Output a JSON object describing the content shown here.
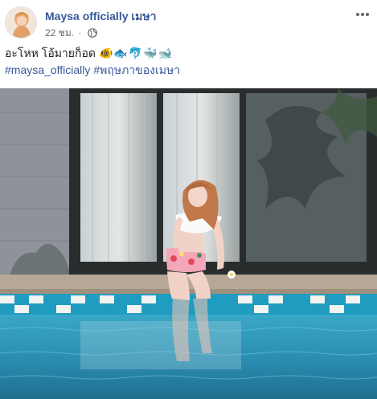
{
  "post": {
    "author": "Maysa officially เมษา",
    "time": "22 ชม.",
    "separator": "·",
    "privacy_icon": "globe-icon",
    "more_icon": "more-horizontal-icon",
    "caption_text": "อะโหห โอ้มายก็อด",
    "caption_emojis": "🐠🐟🐬🐳🐋",
    "hashtags": [
      "#maysa_officially",
      "#พฤษภาของเมษา"
    ],
    "photo_icon": "pool-photo-image"
  },
  "colors": {
    "author_link": "#385898",
    "meta_text": "#606770",
    "text": "#1c1e21",
    "pool_water": "#2f8fb0"
  }
}
